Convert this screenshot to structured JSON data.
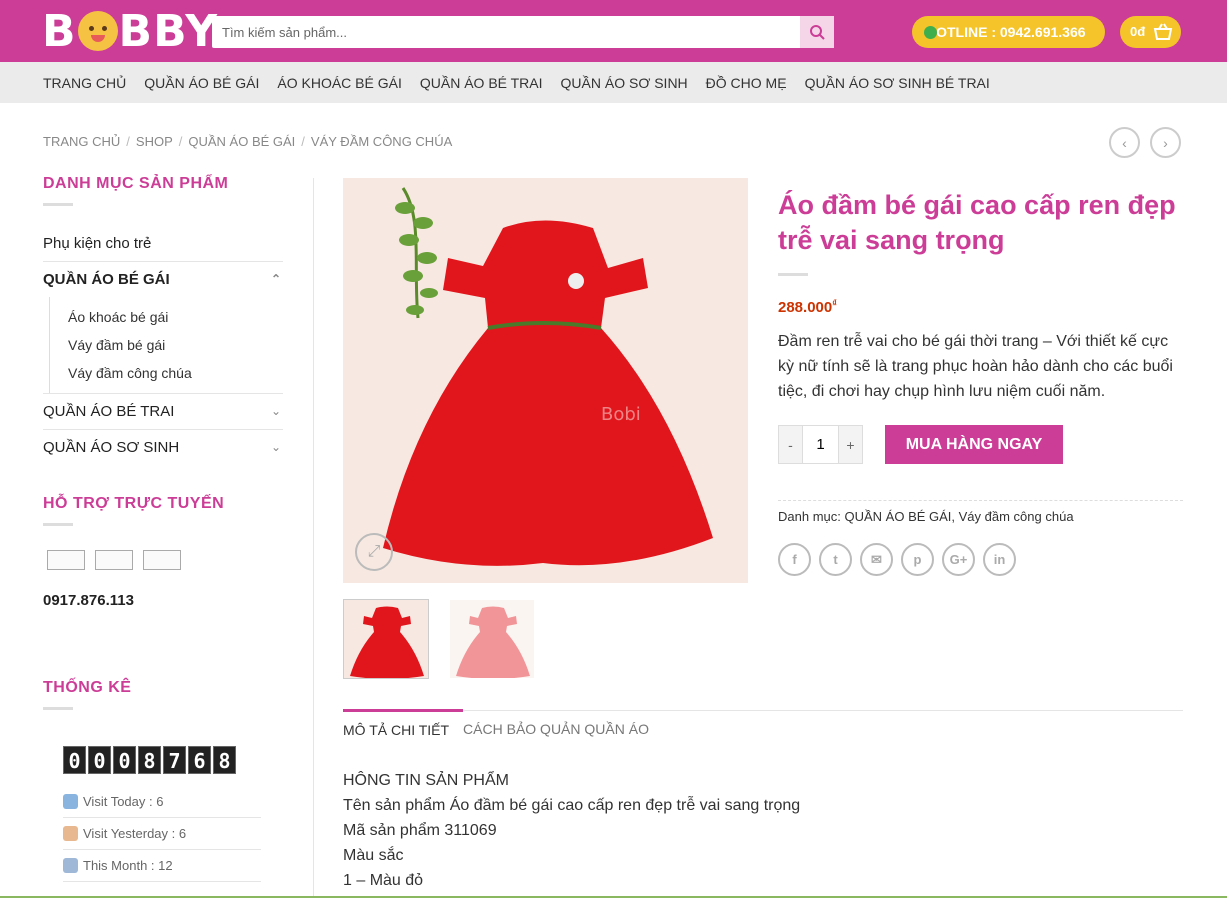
{
  "header": {
    "logo_text": "BOBBY",
    "search_placeholder": "Tìm kiếm sản phẩm...",
    "hotline": "HOTLINE : 0942.691.366",
    "cart_total": "0đ",
    "brand_color": "#cc3d97",
    "accent_color": "#f4c42a"
  },
  "nav": [
    "TRANG CHỦ",
    "QUẦN ÁO BÉ GÁI",
    "ÁO KHOÁC BÉ GÁI",
    "QUẦN ÁO BÉ TRAI",
    "QUẦN ÁO SƠ SINH",
    "ĐỒ CHO MẸ",
    "QUẦN ÁO SƠ SINH BÉ TRAI"
  ],
  "breadcrumb": [
    "TRANG CHỦ",
    "SHOP",
    "QUẦN ÁO BÉ GÁI",
    "VÁY ĐẦM CÔNG CHÚA"
  ],
  "sidebar": {
    "categories_title": "DANH MỤC SẢN PHẨM",
    "cat1": "Phụ kiện cho trẻ",
    "cat2": "QUẦN ÁO BÉ GÁI",
    "sub": [
      "Áo khoác bé gái",
      "Váy đầm bé gái",
      "Váy đầm công chúa"
    ],
    "cat3": "QUẦN ÁO BÉ TRAI",
    "cat4": "QUẦN ÁO SƠ SINH",
    "support_title": "HỖ TRỢ TRỰC TUYẾN",
    "phone": "0917.876.113",
    "stats_title": "THỐNG KÊ",
    "counter": [
      "0",
      "0",
      "0",
      "8",
      "7",
      "6",
      "8"
    ],
    "visit_today": "Visit Today : 6",
    "visit_yesterday": "Visit Yesterday : 6",
    "this_month": "This Month : 12"
  },
  "product": {
    "title": "Áo đầm bé gái cao cấp ren đẹp trễ vai sang trọng",
    "price": "288.000",
    "currency": "₫",
    "description": "Đầm ren trễ vai cho bé gái thời trang – Với thiết kế cực kỳ nữ tính sẽ là trang phục hoàn hảo dành cho các buổi tiệc, đi chơi hay chụp hình lưu niệm cuối năm.",
    "qty_minus": "-",
    "qty_value": "1",
    "qty_plus": "+",
    "buy_label": "MUA HÀNG NGAY",
    "meta_label": "Danh mục:",
    "meta_cats": "QUẦN ÁO BÉ GÁI, Váy đầm công chúa",
    "watermark": "Bobi"
  },
  "share": [
    "f",
    "t",
    "✉",
    "p",
    "G+",
    "in"
  ],
  "tabs": [
    "MÔ TẢ CHI TIẾT",
    "CÁCH BẢO QUẢN QUẦN ÁO"
  ],
  "content": [
    "HÔNG TIN SẢN PHẨM",
    "Tên sản phẩm Áo đầm bé gái cao cấp ren đẹp trễ vai sang trọng",
    "Mã sản phẩm 311069",
    "Màu sắc",
    "1 – Màu đỏ"
  ]
}
